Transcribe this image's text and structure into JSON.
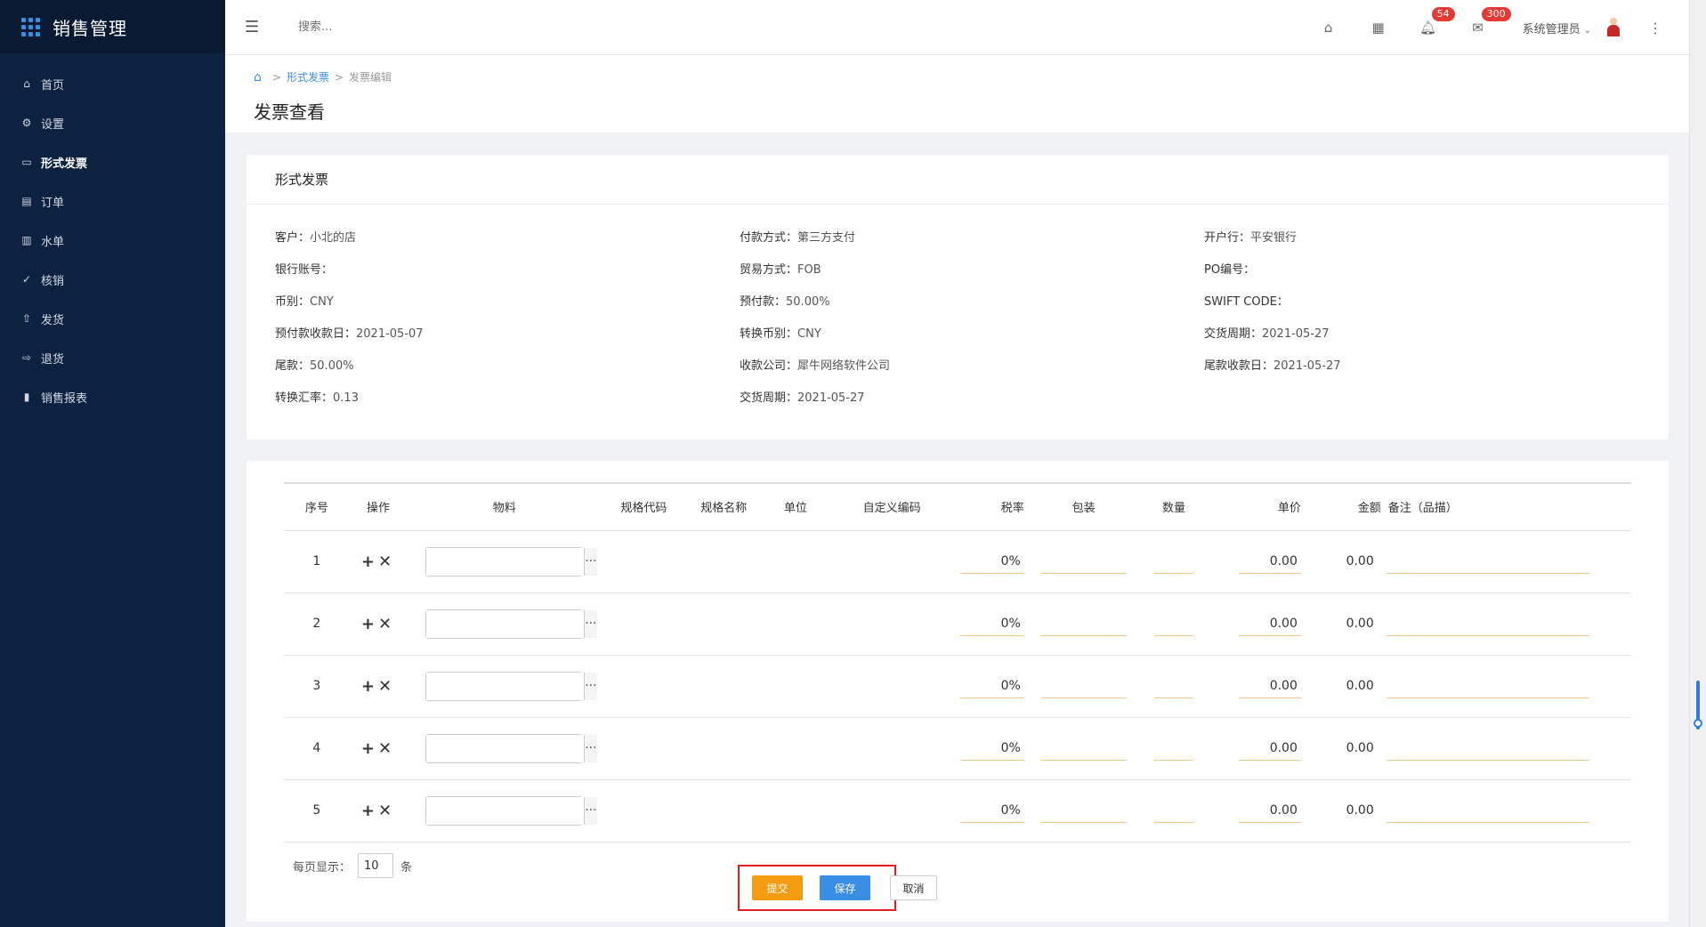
{
  "app": {
    "title": "销售管理"
  },
  "sidebar": {
    "items": [
      {
        "label": "首页",
        "icon": "home-icon",
        "glyph": "⌂"
      },
      {
        "label": "设置",
        "icon": "gear-icon",
        "glyph": "⚙"
      },
      {
        "label": "形式发票",
        "icon": "invoice-icon",
        "glyph": "▭",
        "active": true
      },
      {
        "label": "订单",
        "icon": "order-icon",
        "glyph": "▤"
      },
      {
        "label": "水单",
        "icon": "receipt-icon",
        "glyph": "▥"
      },
      {
        "label": "核销",
        "icon": "check-circle-icon",
        "glyph": "✓"
      },
      {
        "label": "发货",
        "icon": "upload-icon",
        "glyph": "⇧"
      },
      {
        "label": "退货",
        "icon": "logout-icon",
        "glyph": "⇨"
      },
      {
        "label": "销售报表",
        "icon": "bar-chart-icon",
        "glyph": "▮"
      }
    ]
  },
  "topbar": {
    "search_placeholder": "搜索...",
    "notifications_count": "54",
    "messages_count": "300",
    "user_name": "系统管理员"
  },
  "breadcrumb": {
    "link": "形式发票",
    "current": "发票编辑"
  },
  "page": {
    "title": "发票查看"
  },
  "invoice": {
    "card_title": "形式发票",
    "fields": [
      {
        "label": "客户：",
        "value": "小北的店"
      },
      {
        "label": "付款方式：",
        "value": "第三方支付"
      },
      {
        "label": "开户行：",
        "value": "平安银行"
      },
      {
        "label": "银行账号：",
        "value": ""
      },
      {
        "label": "贸易方式：",
        "value": "FOB"
      },
      {
        "label": "PO编号：",
        "value": ""
      },
      {
        "label": "币别：",
        "value": "CNY"
      },
      {
        "label": "预付款：",
        "value": "50.00%"
      },
      {
        "label": "SWIFT CODE：",
        "value": ""
      },
      {
        "label": "预付款收款日：",
        "value": "2021-05-07"
      },
      {
        "label": "转换币别：",
        "value": "CNY"
      },
      {
        "label": "交货周期：",
        "value": "2021-05-27"
      },
      {
        "label": "尾款：",
        "value": "50.00%"
      },
      {
        "label": "收款公司：",
        "value": "犀牛网络软件公司"
      },
      {
        "label": "尾款收款日：",
        "value": "2021-05-27"
      },
      {
        "label": "转换汇率：",
        "value": "0.13"
      },
      {
        "label": "交货周期：",
        "value": "2021-05-27"
      },
      {
        "label": "",
        "value": ""
      }
    ]
  },
  "table": {
    "headers": [
      "序号",
      "操作",
      "物料",
      "规格代码",
      "规格名称",
      "单位",
      "自定义编码",
      "税率",
      "包装",
      "数量",
      "单价",
      "金额",
      "备注（品描）"
    ],
    "add_glyph": "+",
    "remove_glyph": "✕",
    "picker_glyph": "···",
    "rows": [
      {
        "no": "1",
        "tax": "0%",
        "price": "0.00",
        "amount": "0.00"
      },
      {
        "no": "2",
        "tax": "0%",
        "price": "0.00",
        "amount": "0.00"
      },
      {
        "no": "3",
        "tax": "0%",
        "price": "0.00",
        "amount": "0.00"
      },
      {
        "no": "4",
        "tax": "0%",
        "price": "0.00",
        "amount": "0.00"
      },
      {
        "no": "5",
        "tax": "0%",
        "price": "0.00",
        "amount": "0.00"
      }
    ]
  },
  "pager": {
    "label": "每页显示：",
    "value": "10",
    "unit": "条"
  },
  "actions": {
    "submit": "提交",
    "save": "保存",
    "cancel": "取消"
  },
  "colors": {
    "sidebar_bg": "#0d2140",
    "accent": "#3a8ee6",
    "submit": "#f39c12",
    "badge": "#e53935",
    "highlight": "#e02020"
  }
}
